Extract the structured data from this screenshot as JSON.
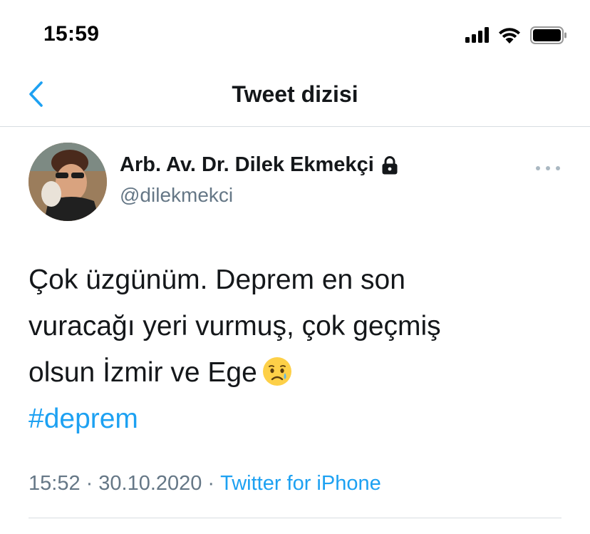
{
  "status_bar": {
    "time": "15:59",
    "signal_icon": "cellular-signal-icon",
    "wifi_icon": "wifi-icon",
    "battery_icon": "battery-icon"
  },
  "nav": {
    "title": "Tweet dizisi",
    "back_icon": "chevron-left-icon"
  },
  "tweet": {
    "author_name": "Arb. Av. Dr. Dilek Ekmekçi",
    "author_handle": "@dilekmekci",
    "protected_icon": "lock-icon",
    "more_icon": "more-options-icon",
    "text_lines": [
      "Çok üzgünüm. Deprem en son",
      "vuracağı yeri vurmuş, çok geçmiş",
      "olsun İzmir ve Ege"
    ],
    "emoji": "crying-face-emoji",
    "hashtag": "#deprem",
    "time": "15:52",
    "separator": "·",
    "date": "30.10.2020",
    "source": "Twitter for iPhone"
  },
  "colors": {
    "accent": "#1da1f2",
    "secondary_text": "#657786",
    "divider": "#d8dde1"
  }
}
